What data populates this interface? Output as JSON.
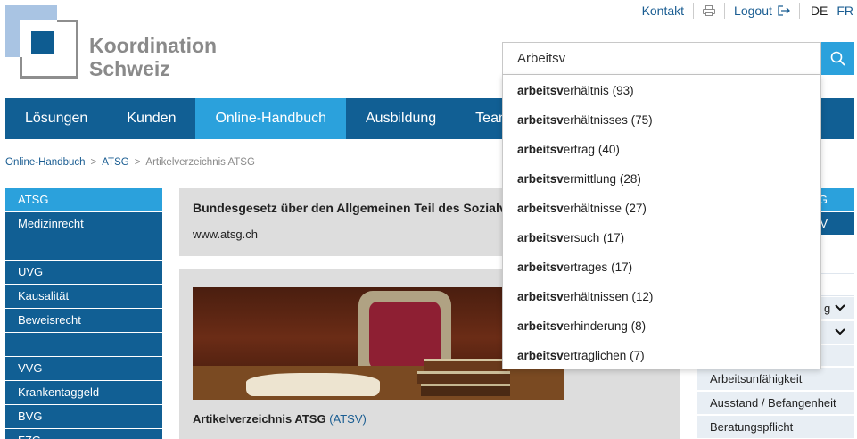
{
  "brand": {
    "line1": "Koordination",
    "line2": "Schweiz"
  },
  "top_bar": {
    "contact": "Kontakt",
    "logout": "Logout",
    "lang_de": "DE",
    "lang_fr": "FR"
  },
  "nav": [
    {
      "label": "Lösungen"
    },
    {
      "label": "Kunden"
    },
    {
      "label": "Online-Handbuch",
      "active": true
    },
    {
      "label": "Ausbildung"
    },
    {
      "label": "Team"
    }
  ],
  "search": {
    "value": "Arbeitsv",
    "suggestions": [
      {
        "prefix": "arbeitsv",
        "rest": "erhältnis",
        "count": "(93)"
      },
      {
        "prefix": "arbeitsv",
        "rest": "erhältnisses",
        "count": "(75)"
      },
      {
        "prefix": "arbeitsv",
        "rest": "ertrag",
        "count": "(40)"
      },
      {
        "prefix": "arbeitsv",
        "rest": "ermittlung",
        "count": "(28)"
      },
      {
        "prefix": "arbeitsv",
        "rest": "erhältnisse",
        "count": "(27)"
      },
      {
        "prefix": "arbeitsv",
        "rest": "ersuch",
        "count": "(17)"
      },
      {
        "prefix": "arbeitsv",
        "rest": "ertrages",
        "count": "(17)"
      },
      {
        "prefix": "arbeitsv",
        "rest": "erhältnissen",
        "count": "(12)"
      },
      {
        "prefix": "arbeitsv",
        "rest": "erhinderung",
        "count": "(8)"
      },
      {
        "prefix": "arbeitsv",
        "rest": "ertraglichen",
        "count": "(7)"
      }
    ]
  },
  "breadcrumb": {
    "item1": "Online-Handbuch",
    "item2": "ATSG",
    "sep": ">",
    "current": "Artikelverzeichnis ATSG"
  },
  "sidebar": [
    {
      "label": "ATSG",
      "active": true
    },
    {
      "label": "Medizinrecht"
    },
    {
      "label": ""
    },
    {
      "label": "UVG"
    },
    {
      "label": "Kausalität"
    },
    {
      "label": "Beweisrecht"
    },
    {
      "label": ""
    },
    {
      "label": "VVG"
    },
    {
      "label": "Krankentaggeld"
    },
    {
      "label": "BVG"
    },
    {
      "label": "FZG"
    }
  ],
  "main": {
    "info_title": "Bundesgesetz über den Allgemeinen Teil des Sozialversicherungsrechts",
    "info_url": "www.atsg.ch",
    "caption_bold": "Artikelverzeichnis ATSG",
    "caption_link": "(ATSV)"
  },
  "right_sidebar": {
    "item_top": "G",
    "item_second": "V",
    "item_chev1": "g",
    "items": [
      "Arbeitsunfähigkeit",
      "Ausstand / Befangenheit",
      "Beratungspflicht"
    ]
  },
  "colors": {
    "nav": "#115f94",
    "accent": "#2ba1dc",
    "link": "#1a5d92",
    "panel": "#dddddd"
  }
}
